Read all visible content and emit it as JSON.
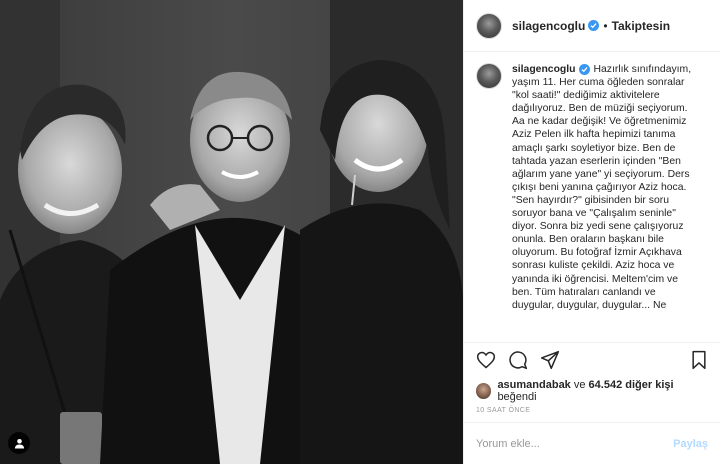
{
  "post": {
    "username": "silagencoglu",
    "follow_status": "Takiptesin",
    "dot": "•",
    "caption_user": "silagencoglu",
    "caption": "Hazırlık sınıfındayım,\nyaşım 11. Her cuma öğleden sonralar\n\"kol saati!\" dediğimiz aktivitelere\ndağılıyoruz. Ben de müziği seçiyorum.\nAa ne kadar değişik! Ve öğretmenimiz\nAziz Pelen ilk hafta hepimizi tanıma\namaçlı şarkı soyletiyor bize. Ben de\ntahtada yazan eserlerin içinden \"Ben\nağlarım yane yane\" yi seçiyorum. Ders\nçıkışı beni yanına çağırıyor Aziz hoca.\n\"Sen hayırdır?\" gibisinden bir soru\nsoruyor bana ve \"Çalışalım seninle\"\ndiyor. Sonra biz yedi sene çalışıyoruz\nonunla. Ben oraların başkanı bile\noluyorum. Bu fotoğraf İzmir Açıkhava\nsonrası kuliste çekildi. Aziz hoca ve\nyanında iki öğrencisi. Meltem'cim ve\nben. Tüm hatıraları canlandı ve\nduygular, duygular, duygular... Ne",
    "likes_user": "asumandabak",
    "likes_conj": " ve ",
    "likes_count": "64.542 diğer kişi",
    "likes_suffix": " beğendi",
    "timestamp": "10 SAAT ÖNCE",
    "comment_placeholder": "Yorum ekle...",
    "post_button": "Paylaş"
  },
  "icons": {
    "like": "heart-icon",
    "comment": "comment-icon",
    "share": "share-icon",
    "save": "bookmark-icon",
    "tag": "user-tag-icon",
    "verified": "verified-badge-icon"
  },
  "colors": {
    "verified": "#3897f0",
    "post_button": "#b3dbff",
    "muted": "#999999",
    "text": "#262626"
  }
}
